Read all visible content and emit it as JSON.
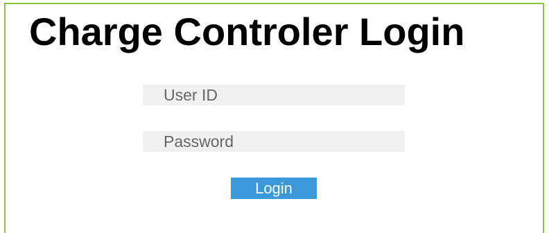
{
  "page": {
    "title": "Charge Controler Login"
  },
  "form": {
    "user_id_placeholder": "User ID",
    "password_placeholder": "Password",
    "login_label": "Login"
  },
  "colors": {
    "frame_border": "#8cc63f",
    "button_background": "#3b99d9",
    "field_background": "#f0f0f0"
  }
}
